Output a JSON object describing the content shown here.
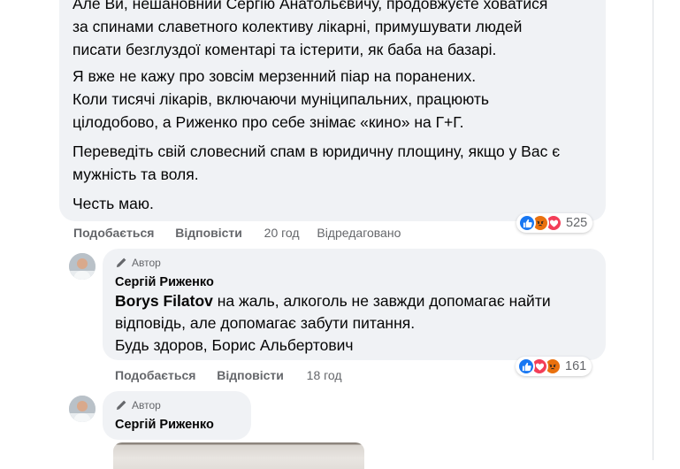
{
  "main_comment": {
    "paragraphs": [
      [
        "Але Ви, нешановний Сергію Анатольєвичу, продовжуєте ховатися",
        "за спинами славетного колективу лікарні, примушувати людей",
        "писати безглуздої коментарі та істерити, як баба на базарі."
      ],
      [
        "Я вже не кажу про зовсім мерзенний піар на поранених.",
        "Коли тисячі лікарів, включаючи муніципальних, працюють",
        "цілодобово, а Риженко про себе знімає «кино» на Г+Г."
      ],
      [
        "Переведіть свій словесний спам в юридичну площину, якщо у Вас є",
        "мужність та воля."
      ],
      [
        "Честь маю."
      ]
    ],
    "actions": {
      "like": "Подобається",
      "reply": "Відповісти",
      "time": "20 год",
      "edited": "Відредаговано"
    },
    "reactions": {
      "icons": [
        "like-icon",
        "angry-icon",
        "love-icon"
      ],
      "count": "525"
    }
  },
  "replies": [
    {
      "badge": "Автор",
      "author": "Сергій Риженко",
      "mention": "Borys Filatov",
      "lines": [
        " на жаль, алкоголь не завжди допомагає найти",
        "відповідь, але допомагає забути питання.",
        "Будь здоров, Борис Альбертович"
      ],
      "actions": {
        "like": "Подобається",
        "reply": "Відповісти",
        "time": "18 год"
      },
      "reactions": {
        "icons": [
          "like-icon",
          "love-icon",
          "angry-icon"
        ],
        "count": "161"
      }
    },
    {
      "badge": "Автор",
      "author": "Сергій Риженко"
    }
  ],
  "colors": {
    "bubble": "#f0f2f5",
    "secondary_text": "#65676b",
    "like": "#1877f2",
    "love": "#f33e58",
    "angry": "#e9710f"
  }
}
